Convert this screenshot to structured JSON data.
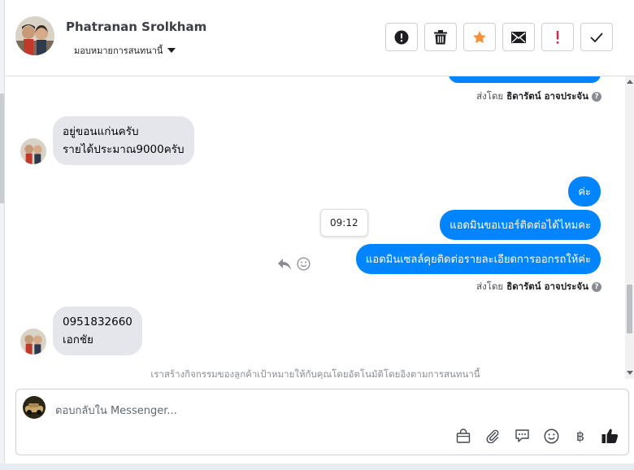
{
  "header": {
    "contact_name": "Phatranan Srolkham",
    "assign_label": "มอบหมายการสนทนานี้",
    "toolbar": [
      {
        "name": "spam-button",
        "icon": "exclamation-circle-icon"
      },
      {
        "name": "delete-button",
        "icon": "trash-icon"
      },
      {
        "name": "star-button",
        "icon": "star-icon"
      },
      {
        "name": "mark-unread-button",
        "icon": "envelope-icon"
      },
      {
        "name": "follow-up-button",
        "icon": "exclamation-icon"
      },
      {
        "name": "done-button",
        "icon": "check-icon"
      }
    ]
  },
  "messages": {
    "sent_by_label": "ส่งโดย",
    "sender_name": "ธิดารัตน์ อาจประจัน",
    "incoming_1": [
      "อยู่ขอนแก่นครับ",
      "รายได้ประมาณ9000ครับ"
    ],
    "outgoing_1": "ค่ะ",
    "outgoing_2": "แอดมินขอเบอร์ติดต่อได้ไหมคะ",
    "outgoing_3": "แอดมินเซลล์คุยติดต่อรายละเอียดการออกรถให้ค่ะ",
    "tooltip_time": "09:12",
    "incoming_2": [
      "0951832660",
      "เอกชัย"
    ]
  },
  "notice": "เราสร้างกิจกรรมของลูกค้าเป้าหมายให้กับคุณโดยอัตโนมัติโดยอิงตามการสนทนานี้",
  "composer": {
    "placeholder": "ตอบกลับใน Messenger...",
    "tools": [
      "shopping-bag-icon",
      "paperclip-icon",
      "saved-reply-icon",
      "emoji-icon",
      "baht-icon",
      "thumbs-up-icon"
    ],
    "baht_symbol": "฿"
  },
  "colors": {
    "accent": "#0084ff",
    "star": "#f7923b",
    "follow_up": "#e41e3f"
  }
}
